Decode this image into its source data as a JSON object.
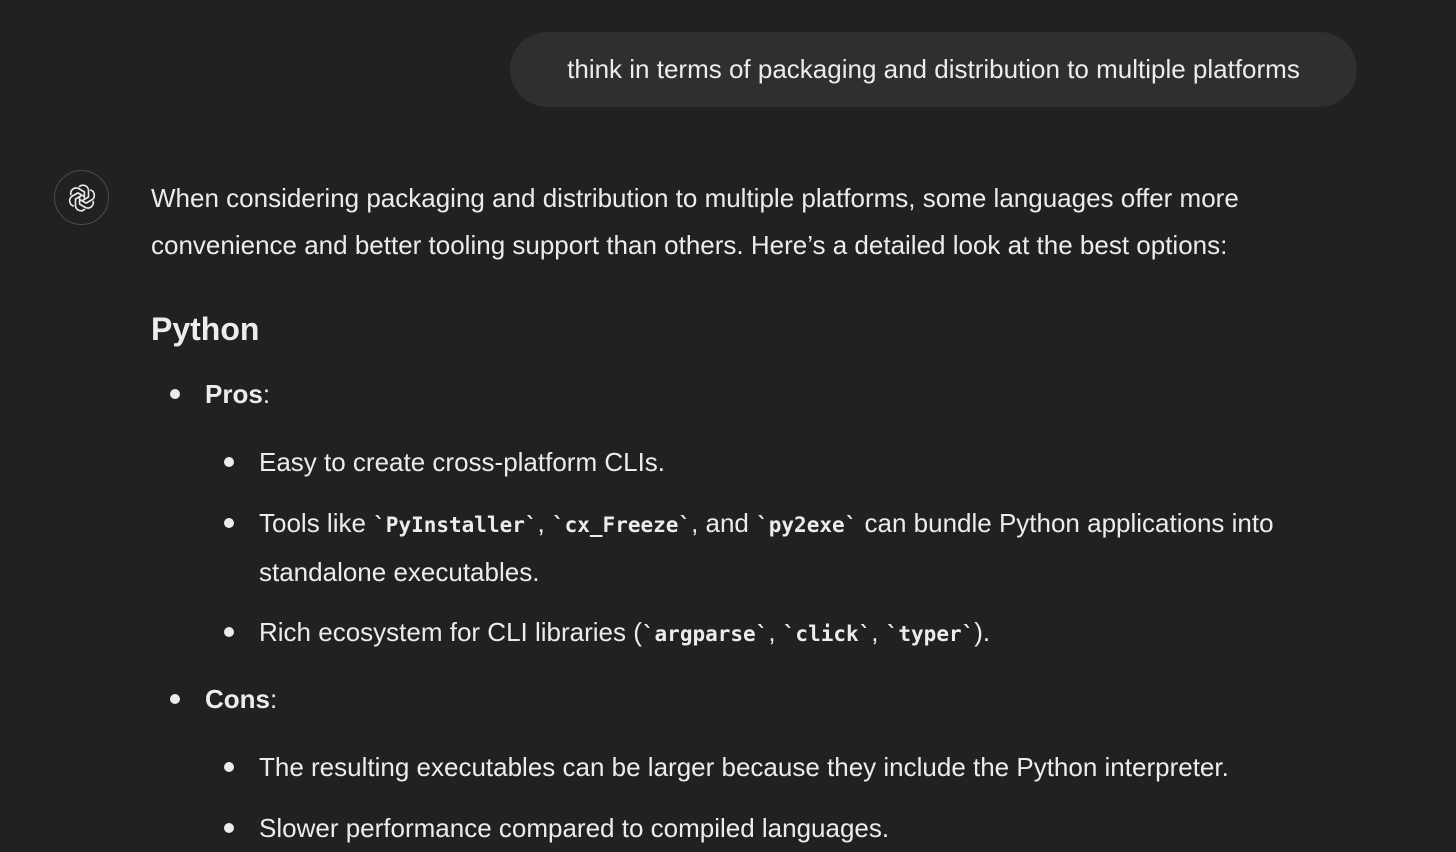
{
  "user_message": "think in terms of packaging and distribution to multiple platforms",
  "assistant": {
    "avatar_icon": "openai-logo-icon",
    "intro": "When considering packaging and distribution to multiple platforms, some languages offer more convenience and better tooling support than others. Here’s a detailed look at the best options:",
    "heading": "Python",
    "pros_label": "Pros",
    "pros_colon": ":",
    "pros": {
      "item1": "Easy to create cross-platform CLIs.",
      "item2": {
        "prefix": "Tools like ",
        "code1": "`PyInstaller`",
        "sep1": ", ",
        "code2": "`cx_Freeze`",
        "sep2": ", and ",
        "code3": "`py2exe`",
        "suffix": " can bundle Python applications into standalone executables."
      },
      "item3": {
        "prefix": "Rich ecosystem for CLI libraries (",
        "code1": "`argparse`",
        "sep1": ", ",
        "code2": "`click`",
        "sep2": ", ",
        "code3": "`typer`",
        "suffix": ")."
      }
    },
    "cons_label": "Cons",
    "cons_colon": ":",
    "cons": {
      "item1": "The resulting executables can be larger because they include the Python interpreter.",
      "item2": "Slower performance compared to compiled languages."
    }
  }
}
